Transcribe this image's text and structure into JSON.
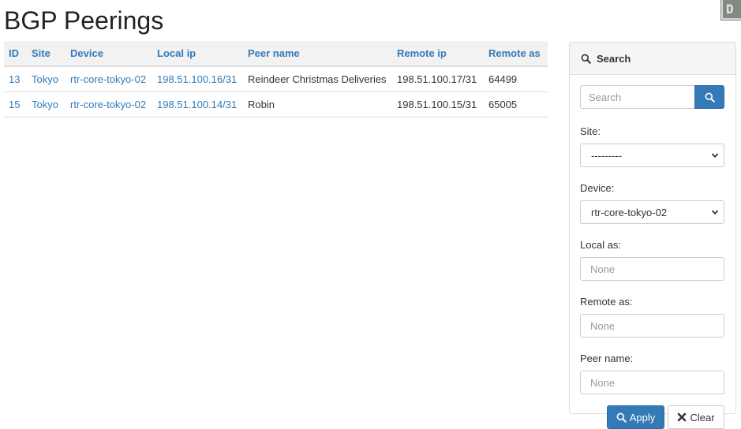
{
  "page": {
    "title": "BGP Peerings"
  },
  "corner_badge": {
    "text": "D"
  },
  "table": {
    "columns": [
      "ID",
      "Site",
      "Device",
      "Local ip",
      "Peer name",
      "Remote ip",
      "Remote as"
    ],
    "rows": [
      {
        "id": "13",
        "site": "Tokyo",
        "device": "rtr-core-tokyo-02",
        "local_ip": "198.51.100.16/31",
        "peer_name": "Reindeer Christmas Deliveries",
        "remote_ip": "198.51.100.17/31",
        "remote_as": "64499"
      },
      {
        "id": "15",
        "site": "Tokyo",
        "device": "rtr-core-tokyo-02",
        "local_ip": "198.51.100.14/31",
        "peer_name": "Robin",
        "remote_ip": "198.51.100.15/31",
        "remote_as": "65005"
      }
    ]
  },
  "search_panel": {
    "heading": "Search",
    "search_placeholder": "Search",
    "site_label": "Site:",
    "site_value": "---------",
    "device_label": "Device:",
    "device_value": "rtr-core-tokyo-02",
    "local_as_label": "Local as:",
    "local_as_placeholder": "None",
    "remote_as_label": "Remote as:",
    "remote_as_placeholder": "None",
    "peer_name_label": "Peer name:",
    "peer_name_placeholder": "None",
    "apply_label": "Apply",
    "clear_label": "Clear"
  },
  "colors": {
    "link": "#337ab7",
    "primary": "#337ab7",
    "header_bg": "#f2f2f2"
  },
  "icons": {
    "search": "magnifier-icon",
    "clear": "x-icon",
    "dropdown": "chevron-down-icon"
  }
}
